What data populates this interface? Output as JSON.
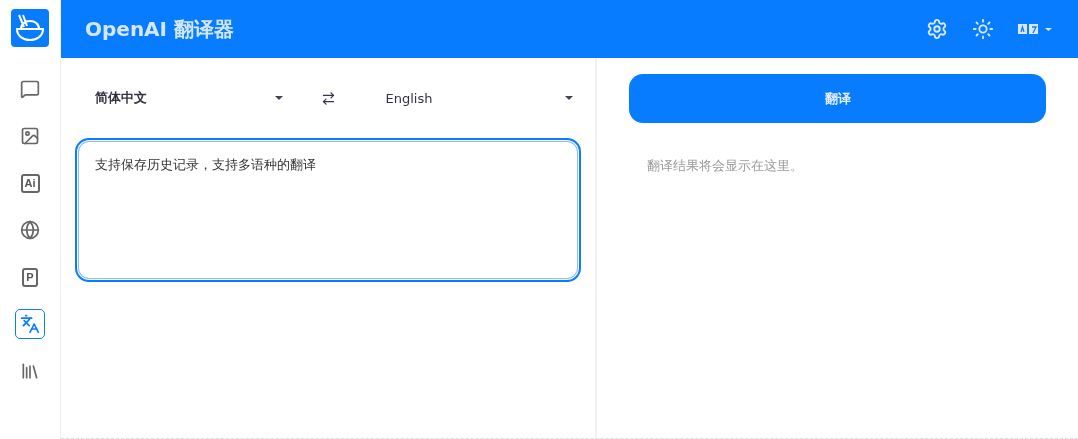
{
  "header": {
    "title": "OpenAI 翻译器"
  },
  "sidebar": {
    "items": [
      {
        "kind": "chat",
        "selected": false
      },
      {
        "kind": "image",
        "selected": false
      },
      {
        "kind": "glyph",
        "glyph": "Ai",
        "selected": false
      },
      {
        "kind": "globe",
        "selected": false
      },
      {
        "kind": "glyph",
        "glyph": "P",
        "selected": false
      },
      {
        "kind": "translate",
        "selected": true
      },
      {
        "kind": "library",
        "selected": false
      }
    ]
  },
  "source": {
    "language": "简体中文",
    "text": "支持保存历史记录，支持多语种的翻译"
  },
  "target": {
    "language": "English"
  },
  "translate_button": "翻译",
  "result": {
    "placeholder": "翻译结果将会显示在这里。"
  }
}
